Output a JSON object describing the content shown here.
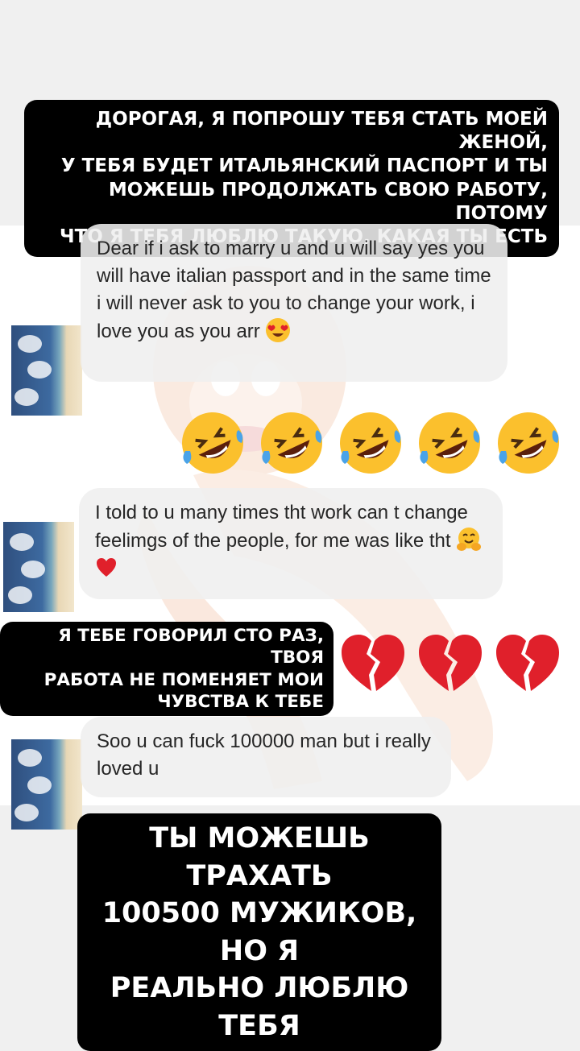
{
  "captions": {
    "top": "ДОРОГАЯ, Я ПОПРОШУ ТЕБЯ СТАТЬ МОЕЙ ЖЕНОЙ,\nУ ТЕБЯ БУДЕТ ИТАЛЬЯНСКИЙ ПАСПОРТ И ТЫ\nМОЖЕШЬ ПРОДОЛЖАТЬ СВОЮ РАБОТУ, ПОТОМУ\nЧТО Я ТЕБЯ ЛЮБЛЮ ТАКУЮ, КАКАЯ ТЫ ЕСТЬ",
    "middle": "Я ТЕБЕ ГОВОРИЛ СТО РАЗ, ТВОЯ\nРАБОТА НЕ ПОМЕНЯЕТ МОИ\nЧУВСТВА К ТЕБЕ",
    "bottom": "ТЫ МОЖЕШЬ ТРАХАТЬ\n100500 МУЖИКОВ, НО Я\nРЕАЛЬНО ЛЮБЛЮ ТЕБЯ"
  },
  "messages": [
    {
      "text": "Dear if i ask to marry u and u will say yes you will have italian passport and in the same time i will never ask to you to change your work,  i love you as you arr",
      "emoji": "heart-eyes-icon"
    },
    {
      "text": "I told to u many times tht work can t change feelimgs of the people, for me was like tht",
      "emoji": "hugging-face-icon, red-heart-icon"
    },
    {
      "text": "Soo u can fuck 100000 man but i really loved u"
    }
  ],
  "reactions": {
    "laughing_count": 5,
    "laughing_icon": "rolling-on-floor-laughing-icon",
    "broken_heart_count": 3,
    "broken_heart_icon": "broken-heart-icon"
  },
  "colors": {
    "caption_bg": "#000000",
    "caption_text": "#ffffff",
    "bubble_bg": "#efefef",
    "bubble_text": "#262626",
    "emoji_yellow": "#fbc02d",
    "heart_red": "#e0202b"
  }
}
